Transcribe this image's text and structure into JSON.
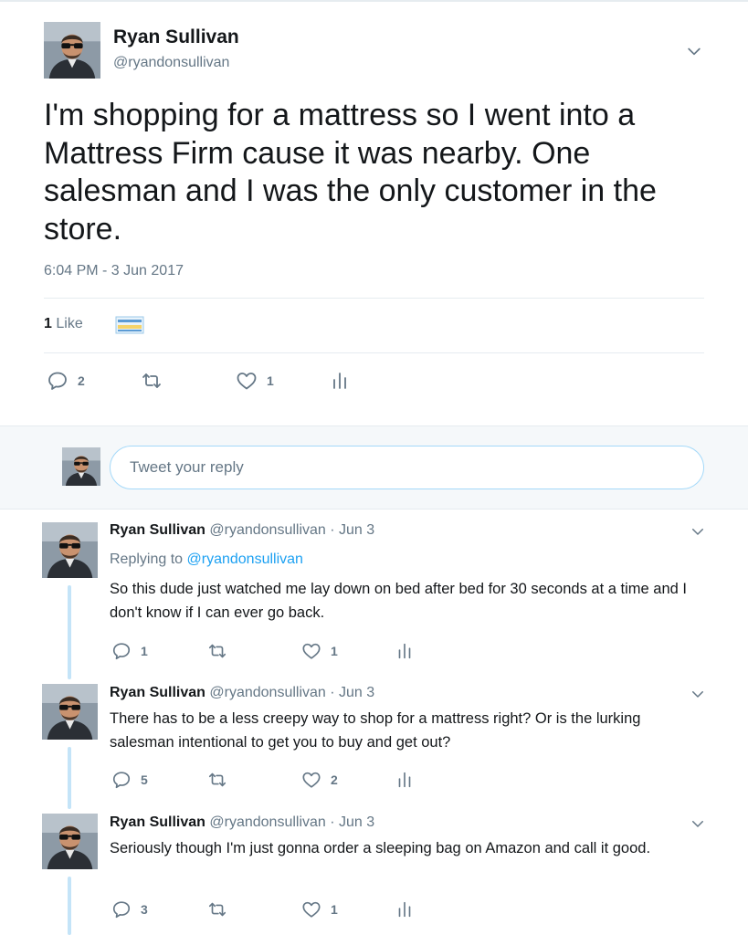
{
  "main_tweet": {
    "name": "Ryan Sullivan",
    "handle": "@ryandonsullivan",
    "text": "I'm shopping for a mattress so I went into a Mattress Firm cause it was nearby. One salesman and I was the only customer in the store.",
    "timestamp": "6:04 PM - 3 Jun 2017",
    "likes_count": "1",
    "likes_label": "Like",
    "actions": {
      "replies": "2",
      "retweets": "",
      "likes": "1"
    }
  },
  "reply_box": {
    "placeholder": "Tweet your reply"
  },
  "replies": [
    {
      "name": "Ryan Sullivan",
      "handle": "@ryandonsullivan",
      "date": "· Jun 3",
      "replying_label": "Replying to",
      "replying_to": "@ryandonsullivan",
      "text": "So this dude just watched me lay down on bed after bed for 30 seconds at a time and I don't know if I can ever go back.",
      "actions": {
        "replies": "1",
        "retweets": "",
        "likes": "1"
      }
    },
    {
      "name": "Ryan Sullivan",
      "handle": "@ryandonsullivan",
      "date": "· Jun 3",
      "text": "There has to be a less creepy way to shop for a mattress right? Or is the lurking salesman intentional to get you to buy and get out?",
      "actions": {
        "replies": "5",
        "retweets": "",
        "likes": "2"
      }
    },
    {
      "name": "Ryan Sullivan",
      "handle": "@ryandonsullivan",
      "date": "· Jun 3",
      "text": "Seriously though I'm just gonna order a sleeping bag on Amazon and call it good.",
      "actions": {
        "replies": "3",
        "retweets": "",
        "likes": "1"
      }
    }
  ],
  "icons": {
    "reply": "speech-bubble-icon",
    "retweet": "retweet-icon",
    "like": "heart-icon",
    "analytics": "bar-chart-icon",
    "more": "chevron-down-icon"
  },
  "colors": {
    "link": "#1da1f2",
    "muted": "#657786",
    "thread_line": "#c4e4f8",
    "band": "#f5f8fa"
  }
}
